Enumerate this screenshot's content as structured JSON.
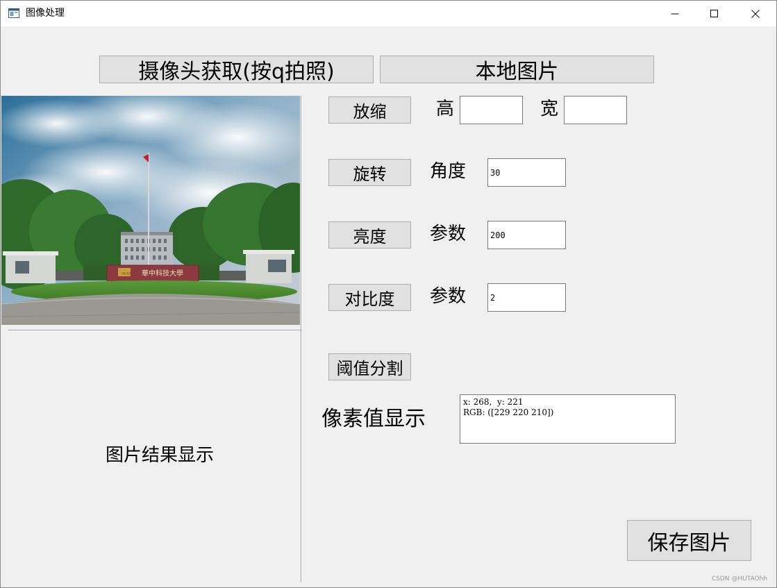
{
  "window": {
    "title": "图像处理",
    "icon": "app-window-icon",
    "controls": [
      "minimize-icon",
      "maximize-icon",
      "close-icon"
    ]
  },
  "toolbar": {
    "camera_label": "摄像头获取(按q拍照)",
    "local_label": "本地图片"
  },
  "zoom": {
    "button_label": "放缩",
    "height_label": "高",
    "width_label": "宽",
    "height_value": "",
    "width_value": ""
  },
  "rotate": {
    "button_label": "旋转",
    "param_label": "角度",
    "value": "30"
  },
  "brightness": {
    "button_label": "亮度",
    "param_label": "参数",
    "value": "200"
  },
  "contrast": {
    "button_label": "对比度",
    "param_label": "参数",
    "value": "2"
  },
  "threshold": {
    "button_label": "阈值分割"
  },
  "pixel": {
    "label": "像素值显示",
    "line1": "x: 268,  y: 221",
    "line2": "RGB: ([229 220 210])"
  },
  "result": {
    "label": "图片结果显示"
  },
  "save": {
    "button_label": "保存图片"
  },
  "photo": {
    "sign_text": "華中科技大學",
    "sign_logo": "HUST"
  },
  "watermark": "CSDN @HUTAOhh",
  "colors": {
    "window_bg": "#f0f0f0",
    "button_bg": "#e1e1e1",
    "button_border": "#adadad"
  }
}
